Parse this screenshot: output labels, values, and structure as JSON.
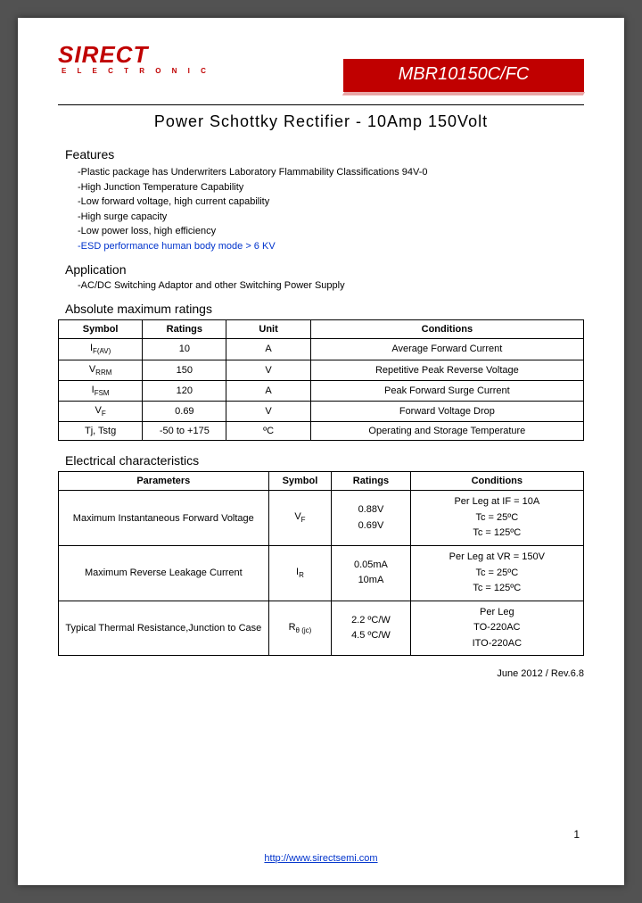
{
  "brand": {
    "name": "SIRECT",
    "sub": "E L E C T R O N I C"
  },
  "part_number": "MBR10150C/FC",
  "subtitle": "Power Schottky Rectifier - 10Amp 150Volt",
  "sections": {
    "features_title": "Features",
    "features": [
      "Plastic package has Underwriters Laboratory Flammability Classifications 94V-0",
      "High Junction Temperature Capability",
      "Low forward voltage, high current capability",
      "High surge capacity",
      "Low power loss, high efficiency",
      "ESD performance human body mode > 6 KV"
    ],
    "application_title": "Application",
    "applications": [
      "AC/DC Switching Adaptor and other Switching Power Supply"
    ],
    "amr_title": "Absolute maximum ratings",
    "ec_title": "Electrical characteristics"
  },
  "amr_table": {
    "headers": [
      "Symbol",
      "Ratings",
      "Unit",
      "Conditions"
    ],
    "rows": [
      {
        "symbol": "IF(AV)",
        "ratings": "10",
        "unit": "A",
        "conditions": "Average Forward Current"
      },
      {
        "symbol": "VRRM",
        "ratings": "150",
        "unit": "V",
        "conditions": "Repetitive Peak Reverse Voltage"
      },
      {
        "symbol": "IFSM",
        "ratings": "120",
        "unit": "A",
        "conditions": "Peak Forward Surge Current"
      },
      {
        "symbol": "VF",
        "ratings": "0.69",
        "unit": "V",
        "conditions": "Forward Voltage Drop"
      },
      {
        "symbol": "Tj, Tstg",
        "ratings": "-50 to +175",
        "unit": "ºC",
        "conditions": "Operating and Storage Temperature"
      }
    ]
  },
  "ec_table": {
    "headers": [
      "Parameters",
      "Symbol",
      "Ratings",
      "Conditions"
    ],
    "rows": [
      {
        "param": "Maximum Instantaneous Forward Voltage",
        "symbol": "VF",
        "ratings": [
          "",
          "0.88V",
          "0.69V"
        ],
        "conditions": [
          "Per Leg at IF = 10A",
          "Tc = 25ºC",
          "Tc = 125ºC"
        ]
      },
      {
        "param": "Maximum Reverse Leakage Current",
        "symbol": "IR",
        "ratings": [
          "",
          "0.05mA",
          "10mA"
        ],
        "conditions": [
          "Per Leg at VR = 150V",
          "Tc = 25ºC",
          "Tc = 125ºC"
        ]
      },
      {
        "param": "Typical Thermal Resistance,Junction to Case",
        "symbol": "Rθ(jc)",
        "ratings": [
          "",
          "2.2 ºC/W",
          "4.5 ºC/W"
        ],
        "conditions": [
          "Per Leg",
          "TO-220AC",
          "ITO-220AC"
        ]
      }
    ]
  },
  "rev_date": "June 2012 / Rev.6.8",
  "footer_url": "http://www.sirectsemi.com",
  "page_number": "1"
}
